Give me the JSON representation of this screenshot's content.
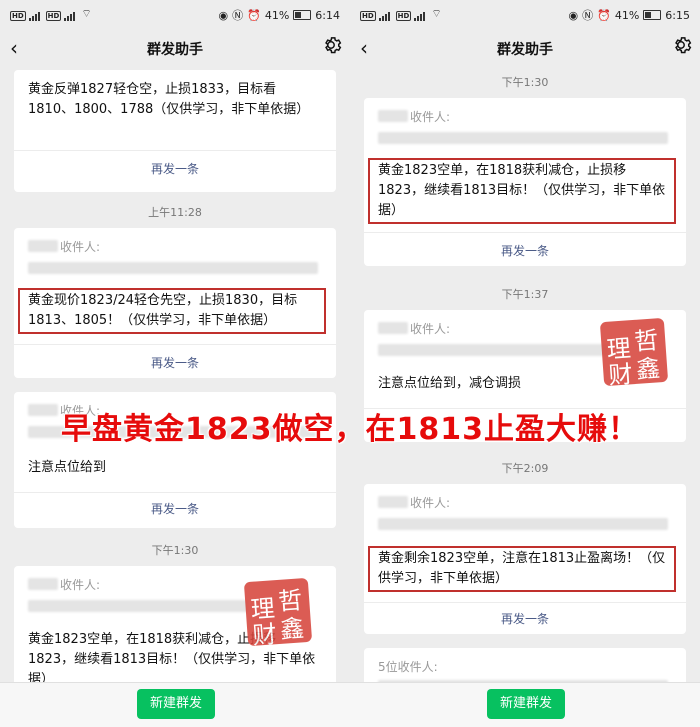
{
  "left": {
    "statusbar": {
      "battery": "41%",
      "clock": "6:14"
    },
    "navbar": {
      "title": "群发助手"
    },
    "cards": [
      {
        "message": "黄金反弹1827轻仓空，止损1833，目标看1810、1800、1788（仅供学习，非下单依据）",
        "resend": "再发一条"
      },
      {
        "time": "上午11:28",
        "recipient": "收件人:",
        "message": "黄金现价1823/24轻仓先空，止损1830，目标1813、1805！（仅供学习，非下单依据）",
        "resend": "再发一条"
      },
      {
        "recipient": "收件人:",
        "message": "注意点位给到",
        "resend": "再发一条"
      },
      {
        "time": "下午1:30",
        "recipient": "收件人:",
        "message": "黄金1823空单，在1818获利减仓，止损移1823，继续看1813目标！（仅供学习，非下单依据）"
      }
    ],
    "bottom": {
      "new_label": "新建群发"
    }
  },
  "right": {
    "statusbar": {
      "battery": "41%",
      "clock": "6:15"
    },
    "navbar": {
      "title": "群发助手"
    },
    "cards": [
      {
        "time": "下午1:30",
        "recipient": "收件人:",
        "message": "黄金1823空单，在1818获利减仓，止损移1823，继续看1813目标！（仅供学习，非下单依据）",
        "resend": "再发一条"
      },
      {
        "time": "下午1:37",
        "recipient": "收件人:",
        "message": "注意点位给到，减仓调损",
        "resend": "再发一条"
      },
      {
        "time": "下午2:09",
        "recipient": "收件人:",
        "message": "黄金剩余1823空单，注意在1813止盈离场！（仅供学习，非下单依据）",
        "resend": "再发一条"
      },
      {
        "recipient": "5位收件人:"
      }
    ],
    "bottom": {
      "new_label": "新建群发"
    }
  },
  "overlay_caption": "早盘黄金1823做空，在1813止盈大赚！",
  "seal_chars": [
    "哲",
    "理",
    "鑫",
    "财"
  ],
  "colors": {
    "accent_green": "#07c160",
    "highlight_red": "#c0302d",
    "caption_red": "#e60b0b",
    "link": "#4a5a87"
  }
}
